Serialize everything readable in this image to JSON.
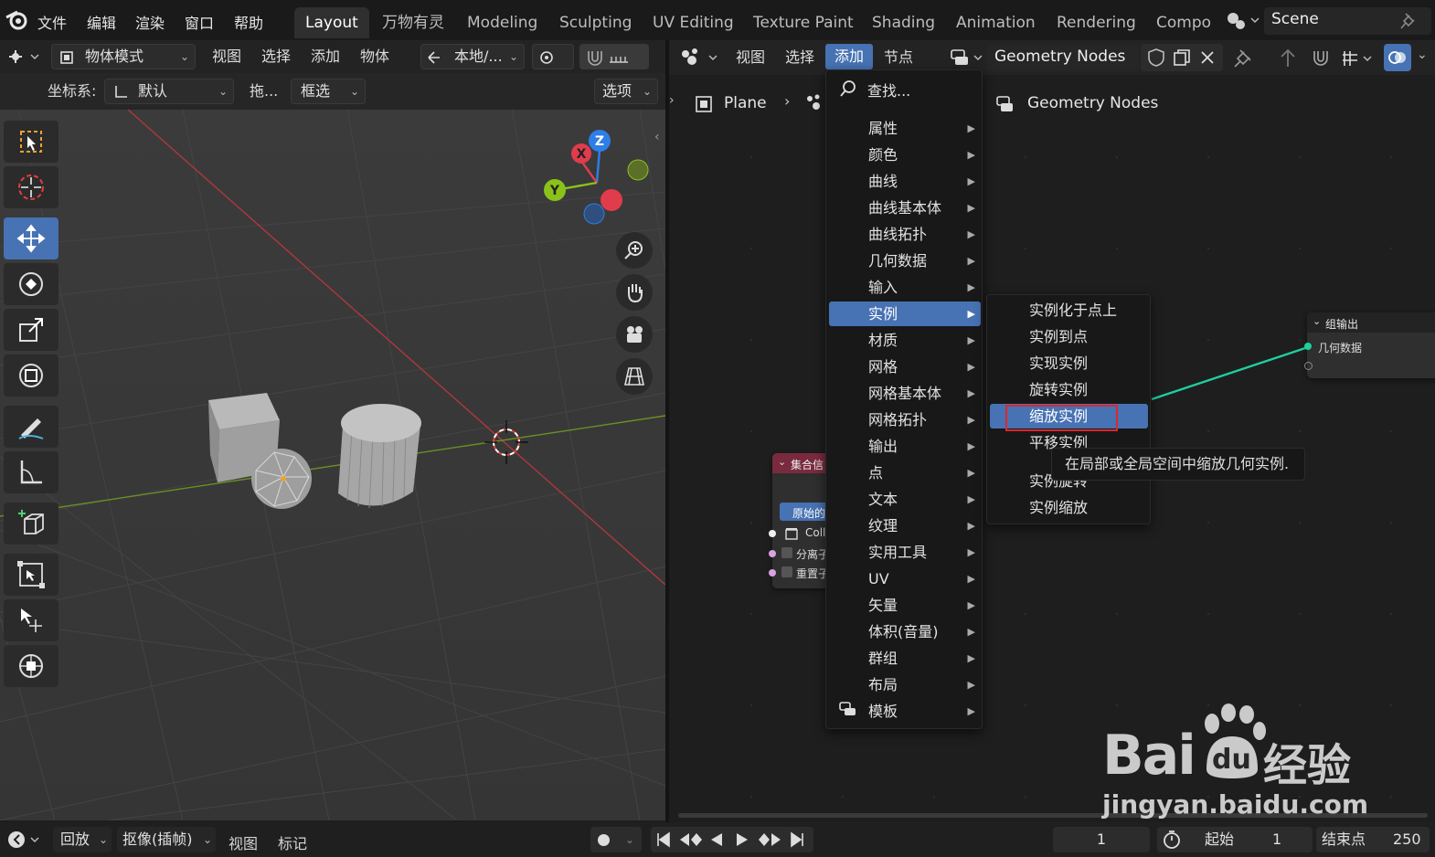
{
  "menubar": {
    "items": [
      "文件",
      "编辑",
      "渲染",
      "窗口",
      "帮助"
    ],
    "workspaces": [
      "Layout",
      "万物有灵",
      "Modeling",
      "Sculpting",
      "UV Editing",
      "Texture Paint",
      "Shading",
      "Animation",
      "Rendering",
      "Compo"
    ],
    "active_workspace": "Layout",
    "scene": "Scene"
  },
  "viewport_header": {
    "mode": "物体模式",
    "menus": [
      "视图",
      "选择",
      "添加",
      "物体"
    ],
    "transform_orientation": "本地/...",
    "coord_label": "坐标系:",
    "coord_value": "默认",
    "drag_label": "拖...",
    "select_box": "框选",
    "options": "选项"
  },
  "gizmo": {
    "x": "X",
    "y": "Y",
    "z": "Z"
  },
  "node_editor_header": {
    "menus": [
      "视图",
      "选择",
      "添加",
      "节点"
    ],
    "active_menu": "添加",
    "tree_name": "Geometry Nodes",
    "breadcrumb_object": "Plane",
    "breadcrumb_tree": "Geometry Nodes"
  },
  "add_menu": {
    "search": "查找...",
    "items": [
      "属性",
      "颜色",
      "曲线",
      "曲线基本体",
      "曲线拓扑",
      "几何数据",
      "输入",
      "实例",
      "材质",
      "网格",
      "网格基本体",
      "网格拓扑",
      "输出",
      "点",
      "文本",
      "纹理",
      "实用工具",
      "UV",
      "矢量",
      "体积(音量)",
      "群组",
      "布局",
      "模板"
    ],
    "highlighted": "实例"
  },
  "instance_submenu": {
    "items": [
      "实例化于点上",
      "实例到点",
      "实现实例",
      "旋转实例",
      "缩放实例",
      "平移实例",
      "实例旋转",
      "实例缩放"
    ],
    "highlighted": "缩放实例"
  },
  "tooltip": "在局部或全局空间中缩放几何实例.",
  "group_output_node": {
    "title": "组输出",
    "socket": "几何数据"
  },
  "collection_node": {
    "title": "集合信",
    "button": "原始的",
    "rows": [
      "Coll",
      "分离子",
      "重置子"
    ]
  },
  "timeline": {
    "playback": "回放",
    "keying": "抠像(插帧)",
    "view": "视图",
    "marker": "标记",
    "current_frame": "1",
    "start_label": "起始",
    "start_value": "1",
    "end_label": "结束点",
    "end_value": "250"
  },
  "watermark": {
    "brand": "Bai",
    "brand_du": "du",
    "suffix": "经验",
    "url": "jingyan.baidu.com"
  },
  "colors": {
    "accent": "#4772b3",
    "highlight_box": "#e0262a",
    "link_green": "#1ecf9e",
    "axis_x": "#e03c4c",
    "axis_y": "#8bc21a",
    "axis_z": "#2e7ee8"
  }
}
